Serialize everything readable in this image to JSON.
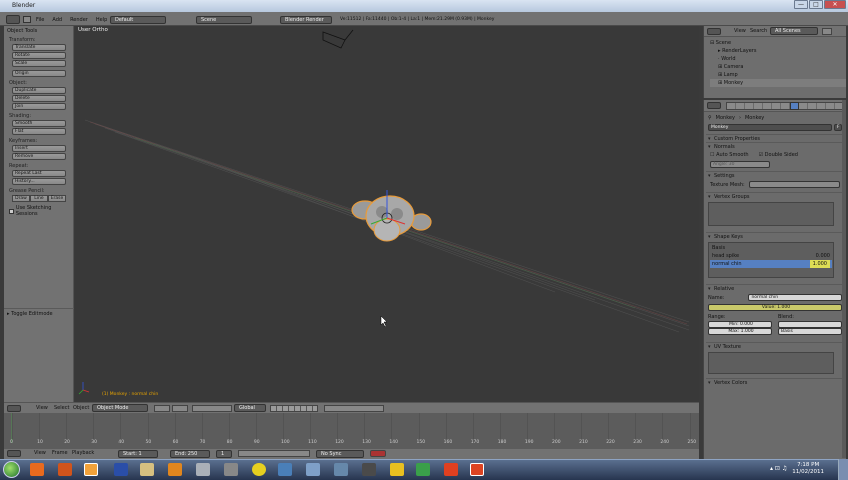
{
  "window": {
    "title": "Blender",
    "min": "—",
    "max": "□",
    "close": "✕"
  },
  "topbar": {
    "menus": [
      "File",
      "Add",
      "Render",
      "Help"
    ],
    "screen": "Default",
    "scene": "Scene",
    "engine": "Blender Render",
    "stats": "Ve:11512 | Fa:11440 | Ob:1-4 | La:1 | Mem:21.29M (0.93M) | Monkey"
  },
  "toolshelf": {
    "title": "Object Tools",
    "groups": [
      {
        "label": "Transform:",
        "buttons": [
          "Translate",
          "Rotate",
          "Scale"
        ]
      },
      {
        "label": "",
        "buttons": [
          "Origin"
        ]
      },
      {
        "label": "Object:",
        "buttons": [
          "Duplicate",
          "Delete",
          "Join"
        ]
      },
      {
        "label": "Shading:",
        "buttons": [
          "Smooth",
          "Flat"
        ]
      },
      {
        "label": "Keyframes:",
        "buttons": [
          "Insert",
          "Remove"
        ]
      },
      {
        "label": "Repeat:",
        "buttons": [
          "Repeat Last",
          "History..."
        ]
      }
    ],
    "grease_label": "Grease Pencil:",
    "grease_buttons": [
      "Draw",
      "Line",
      "Erase"
    ],
    "sketching": "Use Sketching Sessions",
    "toggle": "Toggle Editmode"
  },
  "viewport": {
    "header": "User Ortho",
    "object_info": "(1) Monkey : normal chin",
    "mode": "Object Mode",
    "orientation": "Global",
    "menus": [
      "View",
      "Select",
      "Object"
    ]
  },
  "timeline": {
    "ticks": [
      "0",
      "10",
      "20",
      "30",
      "40",
      "50",
      "60",
      "70",
      "80",
      "90",
      "100",
      "110",
      "120",
      "130",
      "140",
      "150",
      "160",
      "170",
      "180",
      "190",
      "200",
      "210",
      "220",
      "230",
      "240",
      "250"
    ],
    "menus": [
      "View",
      "Frame",
      "Playback"
    ],
    "start": "Start: 1",
    "end": "End: 250",
    "current": "1",
    "sync": "No Sync"
  },
  "outliner": {
    "menus": [
      "View",
      "Search"
    ],
    "display": "All Scenes",
    "items": [
      "Scene",
      "RenderLayers",
      "World",
      "Camera",
      "Lamp",
      "Monkey"
    ]
  },
  "properties": {
    "breadcrumb_obj": "Monkey",
    "breadcrumb_data": "Monkey",
    "mesh_name": "Monkey",
    "mesh_user": "F",
    "custom_props": "Custom Properties",
    "normals": "Normals",
    "auto_smooth": "Auto Smooth",
    "double_sided": "Double Sided",
    "angle": "Angle: 30",
    "settings": "Settings",
    "texture_mesh_label": "Texture Mesh:",
    "vertex_groups": "Vertex Groups",
    "shape_keys": "Shape Keys",
    "keys": [
      {
        "name": "Basis",
        "value": ""
      },
      {
        "name": "head spike",
        "value": "0.000"
      },
      {
        "name": "normal chin",
        "value": "1.000"
      }
    ],
    "relative": "Relative",
    "name_label": "Name:",
    "name_value": "normal chin",
    "value": "Value: 1.000",
    "range_label": "Range:",
    "blend_label": "Blend:",
    "min": "Min: 0.000",
    "max": "Max: 1.000",
    "basis": "Basis",
    "uv_texture": "UV Texture",
    "vertex_colors": "Vertex Colors"
  },
  "taskbar": {
    "time": "7:18 PM",
    "date": "11/02/2011"
  },
  "colors": {
    "accent": "#5680c2",
    "selected_outline": "#e89b3a",
    "highlight": "#dddd55"
  }
}
